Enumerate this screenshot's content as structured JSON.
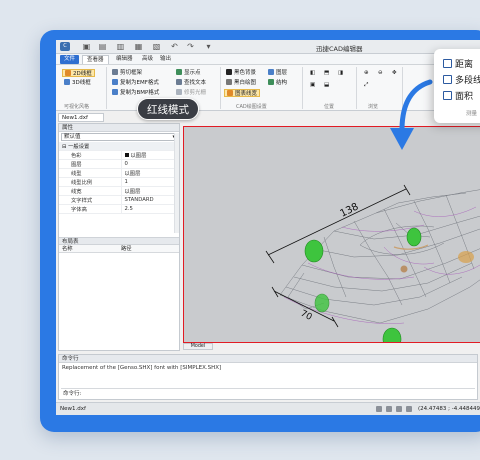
{
  "window": {
    "title": "迅捷CAD编辑器"
  },
  "menu": [
    "文件",
    "查看器",
    "编辑器",
    "高级",
    "输出"
  ],
  "ribbon": {
    "groups": [
      "可视化风格",
      "工具",
      "CAD绘图设置",
      "位置",
      "浏览"
    ],
    "col1": [
      "2D线框",
      "3D线框"
    ],
    "col2": [
      "剪切框架",
      "复制为EMF格式",
      "复制为BMP格式"
    ],
    "col3": [
      "显示点",
      "查找文本",
      "修剪光栅"
    ],
    "col4": [
      "黑色背景",
      "黑白绘图",
      "图层",
      "结构",
      "图表线宽"
    ]
  },
  "document_tab": "New1.dxf",
  "properties": {
    "header": "属性",
    "dropdown": "默认值",
    "section": "一般设置",
    "rows": [
      {
        "key": "色彩",
        "value": "以图层",
        "swatch": true
      },
      {
        "key": "图层",
        "value": "0"
      },
      {
        "key": "线型",
        "value": "以图层"
      },
      {
        "key": "线型比例",
        "value": "1"
      },
      {
        "key": "线宽",
        "value": "以图层"
      },
      {
        "key": "文字样式",
        "value": "STANDARD"
      },
      {
        "key": "字体高",
        "value": "2.5"
      }
    ]
  },
  "layouts_panel": {
    "header": "布局表",
    "columns": [
      "名称",
      "路径"
    ]
  },
  "viewport": {
    "mode_badge": "红线模式",
    "tab": "Model",
    "dimensions": {
      "top": "138",
      "bottom": "70"
    }
  },
  "command": {
    "header": "命令行",
    "output": "Replacement of the [Genso.SHX] font with [SIMPLEX.SHX]",
    "prompt_label": "命令行:"
  },
  "statusbar": {
    "file": "New1.dxf",
    "coords": "(24.47483 ; -4.448449 ; 0)"
  },
  "measure_popup": {
    "items": [
      {
        "label": "距离",
        "icon": "distance-icon"
      },
      {
        "label": "多段线",
        "icon": "polyline-icon"
      },
      {
        "label": "面积",
        "icon": "area-icon"
      }
    ],
    "footer": "测量"
  },
  "colors": {
    "accent": "#2b79e4",
    "highlight_border": "#e11b24",
    "wheel": "#3ec43e"
  }
}
